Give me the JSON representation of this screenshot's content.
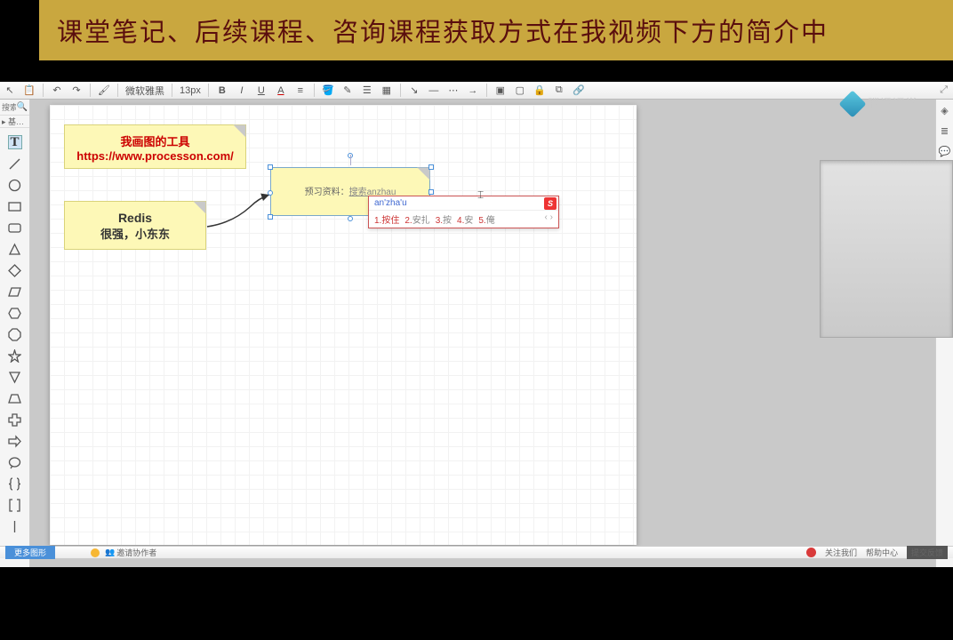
{
  "banner": {
    "text": "课堂笔记、后续课程、咨询课程获取方式在我视频下方的简介中"
  },
  "toolbar": {
    "font_name": "微软雅黑",
    "font_size": "13px"
  },
  "sidebar": {
    "search_placeholder": "搜索",
    "category": "▸ 基…"
  },
  "notes": {
    "tool": {
      "l1": "我画图的工具",
      "l2": "https://www.processon.com/"
    },
    "redis": {
      "l1": "Redis",
      "l2": "很强，小东东"
    },
    "edit": {
      "prefix": "预习资料：",
      "link": "搜索anzhau"
    }
  },
  "ime": {
    "input": "an'zha'u",
    "candidates": [
      {
        "n": "1.",
        "w": "按住"
      },
      {
        "n": "2.",
        "w": "安扎"
      },
      {
        "n": "3.",
        "w": "按"
      },
      {
        "n": "4.",
        "w": "安"
      },
      {
        "n": "5.",
        "w": "俺"
      }
    ]
  },
  "overlay": {
    "logo_text": "腾讯课堂"
  },
  "footer": {
    "more_shapes": "更多图形",
    "author": "邀请协作者",
    "follow": "关注我们",
    "help": "帮助中心",
    "feedback": "提交反馈"
  }
}
